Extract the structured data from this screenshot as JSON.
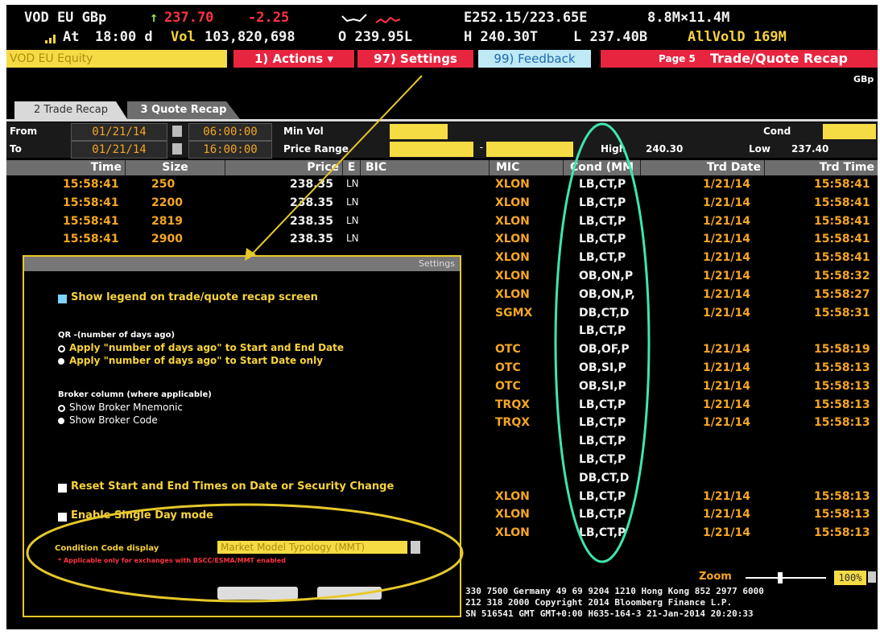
{
  "header": {
    "ticker": "VOD EU GBp",
    "arrow": "↑",
    "last_price": "237.70",
    "change": "-2.25",
    "bid_ask": "E252.15/223.65E",
    "size": "8.8M×11.4M",
    "at_label": "At",
    "time": "18:00 d",
    "vol_label": "Vol",
    "volume": "103,820,698",
    "open": "O 239.95L",
    "high": "H 240.30T",
    "low": "L 237.40B",
    "allvol": "AllVolD 169M"
  },
  "toolbar": {
    "security": "VOD EU Equity",
    "actions": "1) Actions ▾",
    "settings": "97) Settings",
    "feedback": "99) Feedback",
    "page": "Page 5",
    "title": "Trade/Quote Recap",
    "currency": "GBp"
  },
  "tabs": [
    {
      "label": "2 Trade Recap"
    },
    {
      "label": "3 Quote Recap"
    }
  ],
  "filters": {
    "from_label": "From",
    "to_label": "To",
    "from_date": "01/21/14",
    "to_date": "01/21/14",
    "from_time": "06:00:00",
    "to_time": "16:00:00",
    "min_vol_label": "Min Vol",
    "price_range_label": "Price Range",
    "range_dash": "-",
    "cond_label": "Cond",
    "high_label": "High",
    "high_value": "240.30",
    "low_label": "Low",
    "low_value": "237.40"
  },
  "columns": {
    "time": "Time",
    "size": "Size",
    "price": "Price",
    "e": "E",
    "bic": "BIC",
    "mic": "MIC",
    "cond": "Cond (MM",
    "trd_date": "Trd Date",
    "trd_time": "Trd Time"
  },
  "rows": [
    {
      "time": "15:58:41",
      "size": "250",
      "price": "238.35",
      "e": "LN",
      "mic": "XLON",
      "cond": "LB,CT,P",
      "date": "1/21/14",
      "ttime": "15:58:41"
    },
    {
      "time": "15:58:41",
      "size": "2200",
      "price": "238.35",
      "e": "LN",
      "mic": "XLON",
      "cond": "LB,CT,P",
      "date": "1/21/14",
      "ttime": "15:58:41"
    },
    {
      "time": "15:58:41",
      "size": "2819",
      "price": "238.35",
      "e": "LN",
      "mic": "XLON",
      "cond": "LB,CT,P",
      "date": "1/21/14",
      "ttime": "15:58:41"
    },
    {
      "time": "15:58:41",
      "size": "2900",
      "price": "238.35",
      "e": "LN",
      "mic": "XLON",
      "cond": "LB,CT,P",
      "date": "1/21/14",
      "ttime": "15:58:41"
    },
    {
      "time": "",
      "size": "",
      "price": "",
      "e": "",
      "mic": "XLON",
      "cond": "LB,CT,P",
      "date": "1/21/14",
      "ttime": "15:58:41"
    },
    {
      "time": "",
      "size": "",
      "price": "",
      "e": "",
      "mic": "XLON",
      "cond": "OB,ON,P",
      "date": "1/21/14",
      "ttime": "15:58:32"
    },
    {
      "time": "",
      "size": "",
      "price": "",
      "e": "",
      "mic": "XLON",
      "cond": "OB,ON,P,",
      "date": "1/21/14",
      "ttime": "15:58:27"
    },
    {
      "time": "",
      "size": "",
      "price": "",
      "e": "",
      "mic": "SGMX",
      "cond": "DB,CT,D",
      "date": "1/21/14",
      "ttime": "15:58:31"
    },
    {
      "time": "",
      "size": "",
      "price": "",
      "e": "",
      "mic": "",
      "cond": "LB,CT,P",
      "date": "",
      "ttime": ""
    },
    {
      "time": "",
      "size": "",
      "price": "",
      "e": "",
      "mic": "OTC",
      "cond": "OB,OF,P",
      "date": "1/21/14",
      "ttime": "15:58:19"
    },
    {
      "time": "",
      "size": "",
      "price": "",
      "e": "",
      "mic": "OTC",
      "cond": "OB,SI,P",
      "date": "1/21/14",
      "ttime": "15:58:13"
    },
    {
      "time": "",
      "size": "",
      "price": "",
      "e": "",
      "mic": "OTC",
      "cond": "OB,SI,P",
      "date": "1/21/14",
      "ttime": "15:58:13"
    },
    {
      "time": "",
      "size": "",
      "price": "",
      "e": "",
      "mic": "TRQX",
      "cond": "LB,CT,P",
      "date": "1/21/14",
      "ttime": "15:58:13"
    },
    {
      "time": "",
      "size": "",
      "price": "",
      "e": "",
      "mic": "TRQX",
      "cond": "LB,CT,P",
      "date": "1/21/14",
      "ttime": "15:58:13"
    },
    {
      "time": "",
      "size": "",
      "price": "",
      "e": "",
      "mic": "",
      "cond": "LB,CT,P",
      "date": "",
      "ttime": ""
    },
    {
      "time": "",
      "size": "",
      "price": "",
      "e": "",
      "mic": "",
      "cond": "LB,CT,P",
      "date": "",
      "ttime": ""
    },
    {
      "time": "",
      "size": "",
      "price": "",
      "e": "",
      "mic": "",
      "cond": "DB,CT,D",
      "date": "",
      "ttime": ""
    },
    {
      "time": "",
      "size": "",
      "price": "",
      "e": "",
      "mic": "XLON",
      "cond": "LB,CT,P",
      "date": "1/21/14",
      "ttime": "15:58:13"
    },
    {
      "time": "",
      "size": "",
      "price": "",
      "e": "",
      "mic": "XLON",
      "cond": "LB,CT,P",
      "date": "1/21/14",
      "ttime": "15:58:13"
    },
    {
      "time": "",
      "size": "",
      "price": "",
      "e": "",
      "mic": "XLON",
      "cond": "LB,CT,P",
      "date": "1/21/14",
      "ttime": "15:58:13"
    }
  ],
  "footer": {
    "zoom_label": "Zoom",
    "zoom_value": "100%",
    "line1": "330 7500 Germany 49 69 9204 1210 Hong Kong 852 2977 6000",
    "line2": "212 318 2000        Copyright 2014 Bloomberg Finance L.P.",
    "line3": "SN 516541 GMT  GMT+0:00 H635-164-3 21-Jan-2014 20:20:33"
  },
  "settings_dialog": {
    "title": "Settings",
    "show_legend": "Show legend on trade/quote recap screen",
    "qr_heading": "QR -(number of days ago)",
    "qr_opt1": "Apply \"number of days ago\" to Start and End Date",
    "qr_opt2": "Apply \"number of days ago\" to Start Date only",
    "broker_heading": "Broker column (where applicable)",
    "broker_opt1": "Show Broker Mnemonic",
    "broker_opt2": "Show Broker Code",
    "reset_times": "Reset Start and End Times on Date or Security Change",
    "single_day": "Enable Single Day mode",
    "cond_display_label": "Condition Code display",
    "cond_display_value": "Market Model Typology (MMT)",
    "note": "* Applicable only for exchanges with BSCC/ESMA/MMT enabled"
  },
  "colors": {
    "background": "#000000",
    "amber": "#f5a623",
    "red_button": "#e8253f",
    "highlight_yellow": "#e6c82a",
    "annotation_green": "#3ee6b0"
  }
}
